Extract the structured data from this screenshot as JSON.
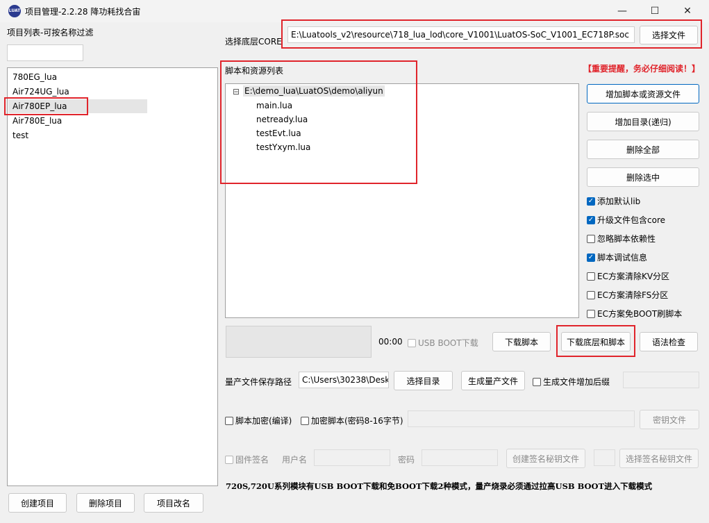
{
  "window": {
    "title": "项目管理-2.2.28 降功耗找合宙",
    "icon_text": "LUAT",
    "minimize_icon": "—",
    "maximize_icon": "☐",
    "close_icon": "✕"
  },
  "left": {
    "filter_label": "项目列表-可按名称过滤",
    "filter_value": "",
    "projects": [
      "780EG_lua",
      "Air724UG_lua",
      "Air780EP_lua",
      "Air780E_lua",
      "test"
    ],
    "selected_index": 2,
    "buttons": {
      "create": "创建项目",
      "delete": "删除项目",
      "rename": "项目改名"
    }
  },
  "core": {
    "label": "选择底层CORE",
    "path": "E:\\Luatools_v2\\resource\\718_lua_lod\\core_V1001\\LuatOS-SoC_V1001_EC718P.soc",
    "select_button": "选择文件"
  },
  "scripts": {
    "label": "脚本和资源列表",
    "warning": "【重要提醒，务必仔细阅读！】",
    "tree_root": "E:\\demo_lua\\LuatOS\\demo\\aliyun",
    "tree_toggle": "⊟",
    "files": [
      "main.lua",
      "netready.lua",
      "testEvt.lua",
      "testYxym.lua"
    ]
  },
  "side_buttons": {
    "add_files": "增加脚本或资源文件",
    "add_dir": "增加目录(递归)",
    "delete_all": "删除全部",
    "delete_selected": "删除选中"
  },
  "options": [
    {
      "label": "添加默认lib",
      "checked": true
    },
    {
      "label": "升级文件包含core",
      "checked": true
    },
    {
      "label": "忽略脚本依赖性",
      "checked": false
    },
    {
      "label": "脚本调试信息",
      "checked": true
    },
    {
      "label": "EC方案清除KV分区",
      "checked": false
    },
    {
      "label": "EC方案清除FS分区",
      "checked": false
    },
    {
      "label": "EC方案免BOOT刷脚本",
      "checked": false
    }
  ],
  "download": {
    "progress": 0,
    "time": "00:00",
    "usb_boot_label": "USB BOOT下载",
    "download_script": "下载脚本",
    "download_core_script": "下载底层和脚本",
    "syntax_check": "语法检查"
  },
  "production": {
    "path_label": "量产文件保存路径",
    "path_value": "C:\\Users\\30238\\Desk",
    "select_dir": "选择目录",
    "generate": "生成量产文件",
    "suffix_label": "生成文件增加后缀",
    "suffix_value": ""
  },
  "encrypt": {
    "encrypt_compile": "脚本加密(编译)",
    "encrypt_script": "加密脚本(密码8-16字节)",
    "key_value": "",
    "key_file": "密钥文件"
  },
  "signature": {
    "firmware_sign": "固件签名",
    "username_label": "用户名",
    "password_label": "密码",
    "create_key": "创建签名秘钥文件",
    "select_key": "选择签名秘钥文件"
  },
  "footer_note": "720S,720U系列模块有USB BOOT下载和免BOOT下载2种模式，量产烧录必须通过拉高USB BOOT进入下载模式",
  "colors": {
    "highlight": "#e0242b",
    "accent": "#0067c0"
  }
}
